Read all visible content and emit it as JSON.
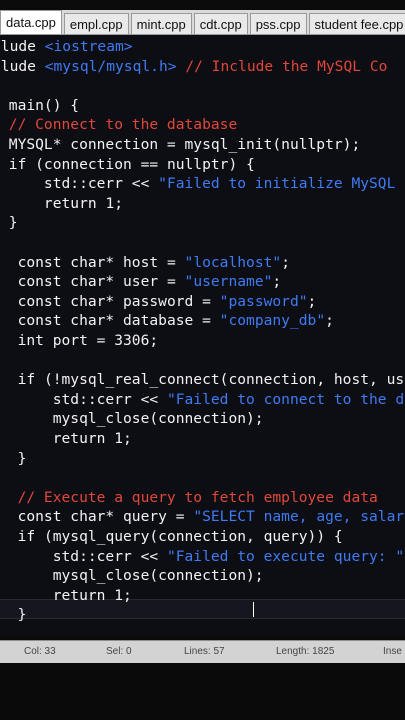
{
  "tabs": [
    "data.cpp",
    "empl.cpp",
    "mint.cpp",
    "cdt.cpp",
    "pss.cpp",
    "student fee.cpp"
  ],
  "code": [
    [
      [
        "plain",
        "clude "
      ],
      [
        "str",
        "<iostream>"
      ]
    ],
    [
      [
        "plain",
        "clude "
      ],
      [
        "str",
        "<mysql/mysql.h>"
      ],
      [
        "plain",
        " "
      ],
      [
        "cmt",
        "// Include the MySQL Co"
      ]
    ],
    [],
    [
      [
        "plain",
        " main() {"
      ]
    ],
    [
      [
        "cmt",
        " // Connect to the database"
      ]
    ],
    [
      [
        "plain",
        " MYSQL* connection = mysql_init(nullptr);"
      ]
    ],
    [
      [
        "kw",
        " if"
      ],
      [
        "plain",
        " (connection == nullptr) {"
      ]
    ],
    [
      [
        "plain",
        "     std::cerr << "
      ],
      [
        "str",
        "\"Failed to initialize MySQL"
      ]
    ],
    [
      [
        "kw",
        "     return"
      ],
      [
        "plain",
        " 1;"
      ]
    ],
    [
      [
        "plain",
        " }"
      ]
    ],
    [],
    [
      [
        "kw",
        "  const char*"
      ],
      [
        "plain",
        " host = "
      ],
      [
        "str",
        "\"localhost\""
      ],
      [
        "plain",
        ";"
      ]
    ],
    [
      [
        "kw",
        "  const char*"
      ],
      [
        "plain",
        " user = "
      ],
      [
        "str",
        "\"username\""
      ],
      [
        "plain",
        ";"
      ]
    ],
    [
      [
        "kw",
        "  const char*"
      ],
      [
        "plain",
        " password = "
      ],
      [
        "str",
        "\"password\""
      ],
      [
        "plain",
        ";"
      ]
    ],
    [
      [
        "kw",
        "  const char*"
      ],
      [
        "plain",
        " database = "
      ],
      [
        "str",
        "\"company_db\""
      ],
      [
        "plain",
        ";"
      ]
    ],
    [
      [
        "kw",
        "  int"
      ],
      [
        "plain",
        " port = 3306;"
      ]
    ],
    [],
    [
      [
        "kw",
        "  if"
      ],
      [
        "plain",
        " (!mysql_real_connect(connection, host, use"
      ]
    ],
    [
      [
        "plain",
        "      std::cerr << "
      ],
      [
        "str",
        "\"Failed to connect to the da"
      ]
    ],
    [
      [
        "plain",
        "      mysql_close(connection);"
      ]
    ],
    [
      [
        "kw",
        "      return"
      ],
      [
        "plain",
        " 1;"
      ]
    ],
    [
      [
        "plain",
        "  }"
      ]
    ],
    [],
    [
      [
        "cmt",
        "  // Execute a query to fetch employee data"
      ]
    ],
    [
      [
        "kw",
        "  const char*"
      ],
      [
        "plain",
        " query = "
      ],
      [
        "str",
        "\"SELECT name, age, salary"
      ]
    ],
    [
      [
        "kw",
        "  if"
      ],
      [
        "plain",
        " (mysql_query(connection, query)) {"
      ]
    ],
    [
      [
        "plain",
        "      std::cerr << "
      ],
      [
        "str",
        "\"Failed to execute query: \""
      ],
      [
        "plain",
        " <"
      ]
    ],
    [
      [
        "plain",
        "      mysql_close(connection);"
      ]
    ],
    [
      [
        "kw",
        "      return"
      ],
      [
        "plain",
        " 1;"
      ]
    ],
    [
      [
        "plain",
        "  }"
      ]
    ]
  ],
  "status": {
    "col": "Col: 33",
    "sel": "Sel: 0",
    "lines": "Lines: 57",
    "length": "Length: 1825",
    "mode": "Inse"
  }
}
